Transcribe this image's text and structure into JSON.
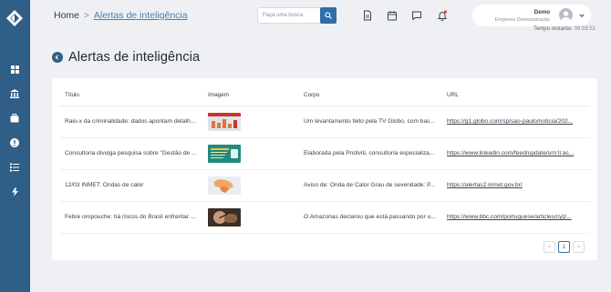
{
  "breadcrumb": {
    "home": "Home",
    "separator": ">",
    "current": "Alertas de inteligência"
  },
  "search": {
    "placeholder": "Faça uma busca"
  },
  "user": {
    "name": "Demo",
    "company": "Empresa Demonstração"
  },
  "session": {
    "label": "Tempo restante:",
    "value": "09:59:51"
  },
  "page": {
    "title": "Alertas de inteligência"
  },
  "table": {
    "columns": [
      "Título",
      "Imagem",
      "Corpo",
      "URL"
    ],
    "rows": [
      {
        "title": "Raio-x da criminalidade: dados apontam detalh...",
        "image": "crime-chart-thumbnail",
        "body": "Um levantamento feito pela TV Globo, com bas...",
        "url": "https://g1.globo.com/sp/sao-paulo/noticia/202..."
      },
      {
        "title": "Consultoria divulga pesquisa sobre \"Gestão de ...",
        "image": "teal-survey-thumbnail",
        "body": "Elaborada pela Protiviti, consultoria especializa...",
        "url": "https://www.linkedin.com/feed/update/urn:li:ac..."
      },
      {
        "title": "12/03 INMET: Ondas de calor",
        "image": "brazil-map-thumbnail",
        "body": "Aviso de: Onda de Calor Grau de severidade: P...",
        "url": "https://alertas2.inmet.gov.br/"
      },
      {
        "title": "Febre oropouche: há riscos do Brasil enfrentar ...",
        "image": "mosquito-thumbnail",
        "body": "O Amazonas declarou que está passando por u...",
        "url": "https://www.bbc.com/portuguese/articles/cyjz..."
      }
    ]
  },
  "pagination": {
    "prev": "<",
    "current": "1",
    "next": ">"
  },
  "colors": {
    "sidebar": "#2f5e86",
    "accent": "#2f6ea8",
    "background": "#eef0f3"
  }
}
